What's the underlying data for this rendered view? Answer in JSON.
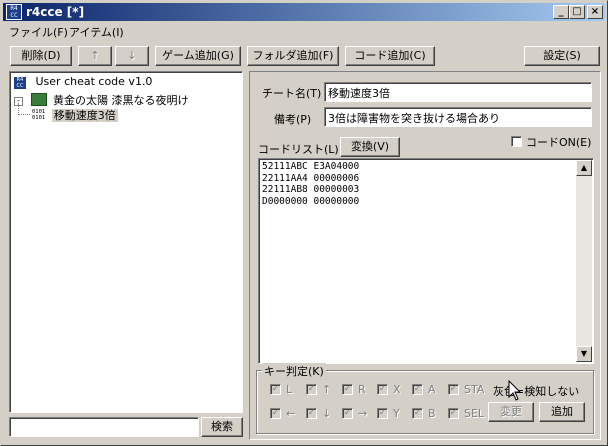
{
  "window": {
    "title": "r4cce [*]",
    "icon_text": "R4CC"
  },
  "menu": [
    {
      "label": "ファイル(F)"
    },
    {
      "label": "アイテム(I)"
    }
  ],
  "toolbar": {
    "delete": "削除(D)",
    "up": "↑",
    "down": "↓",
    "add_game": "ゲーム追加(G)",
    "add_folder": "フォルダ追加(F)",
    "add_code": "コード追加(C)",
    "settings": "設定(S)"
  },
  "tree": {
    "root": "User cheat code v1.0",
    "game": "黄金の太陽 漆黒なる夜明け",
    "code": "移動速度3倍",
    "code_icon_text": "0101\n0101"
  },
  "search": {
    "value": "",
    "button": "検索"
  },
  "detail": {
    "cheat_name_label": "チート名(T)",
    "cheat_name_value": "移動速度3倍",
    "note_label": "備考(P)",
    "note_value": "3倍は障害物を突き抜ける場合あり",
    "code_list_label": "コードリスト(L)",
    "convert_button": "変換(V)",
    "code_on_label": "コードON(E)",
    "code_on_checked": false,
    "codes": "52111ABC E3A04000\n22111AA4 00000006\n22111AB8 00000003\nD0000000 00000000"
  },
  "key_judge": {
    "label": "キー判定(K)",
    "row1": [
      "L",
      "↑",
      "R",
      "X",
      "A",
      "STA"
    ],
    "row2": [
      "←",
      "↓",
      "→",
      "Y",
      "B",
      "SEL"
    ],
    "gray_note": "灰色=検知しない",
    "change_button": "変更",
    "add_button": "追加"
  },
  "colors": {
    "titlebar_start": "#0a246a",
    "titlebar_end": "#a6caf0",
    "selection": "#d4d0c8"
  }
}
